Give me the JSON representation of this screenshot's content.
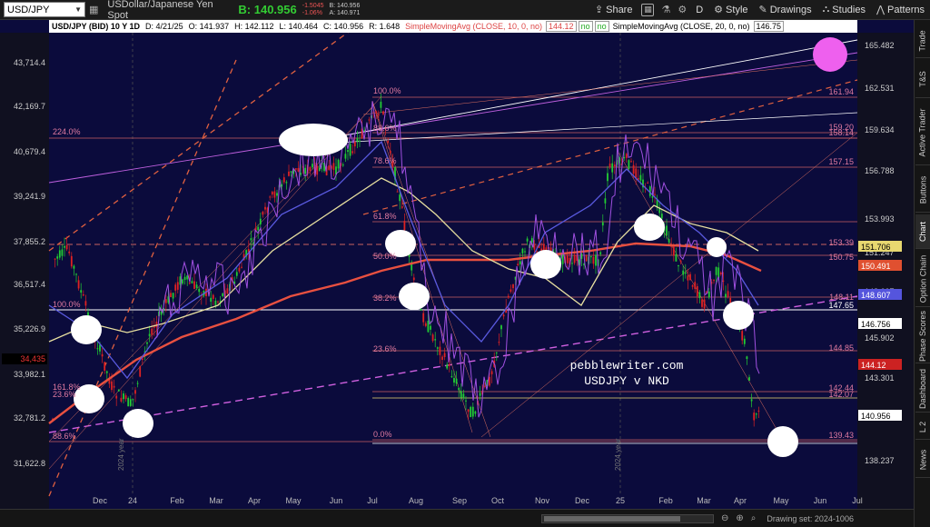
{
  "toolbar": {
    "symbol": "USD/JPY",
    "description": "USDollar/Japanese Yen Spot",
    "bid": "B: 140.956",
    "change": "-1.5045",
    "change_pct": "-1.06%",
    "bid_small": "B: 140.956",
    "ask_small": "A: 140.971",
    "share_label": "Share",
    "style_label": "Style",
    "drawings_label": "Drawings",
    "studies_label": "Studies",
    "patterns_label": "Patterns",
    "period_label": "D"
  },
  "studybar": {
    "title": "USD/JPY (BID) 10 Y 1D",
    "date": "D: 4/21/25",
    "open": "O: 141.937",
    "high": "H: 142.112",
    "low": "L: 140.464",
    "close": "C: 140.956",
    "range": "R: 1.648",
    "sma10": "SimpleMovingAvg (CLOSE, 10, 0, no)",
    "sma10_val": "144.12",
    "no1": "no",
    "no2": "no",
    "sma20": "SimpleMovingAvg (CLOSE, 20, 0, no)",
    "sma20_val": "146.75"
  },
  "right_axis": [
    "165.482",
    "162.531",
    "159.634",
    "156.788",
    "153.993",
    "151.247",
    "148.607",
    "146.756",
    "145.902",
    "143.301",
    "140.956",
    "138.237"
  ],
  "left_axis": [
    "43,714.4",
    "42,169.7",
    "40,679.4",
    "39,241.9",
    "37,855.2",
    "36,517.4",
    "35,226.9",
    "33,982.1",
    "32,781.2",
    "31,622.8"
  ],
  "left_marker": "34,435",
  "x_axis": [
    "Dec",
    "24",
    "Feb",
    "Mar",
    "Apr",
    "May",
    "Jun",
    "Jul",
    "Aug",
    "Sep",
    "Oct",
    "Nov",
    "Dec",
    "25",
    "Feb",
    "Mar",
    "Apr",
    "May",
    "Jun",
    "Jul"
  ],
  "year_labels": [
    "2024 year",
    "2024 year"
  ],
  "fib_left": [
    "224.0%",
    "100.0%",
    "161.8%",
    "23.6%",
    "88.6%"
  ],
  "fib_mid": [
    "100.0%",
    "88.6%",
    "78.6%",
    "61.8%",
    "50.0%",
    "38.2%",
    "23.6%",
    "0.0%"
  ],
  "fib_right": [
    "161.94",
    "159.20",
    "158.14",
    "157.15",
    "153.39",
    "150.75",
    "148.11",
    "147.65",
    "144.85",
    "142.44",
    "142.07",
    "139.43"
  ],
  "price_tags": [
    {
      "text": "151.706",
      "color": "#e8d870"
    },
    {
      "text": "150.491",
      "color": "#e05030"
    },
    {
      "text": "148.607",
      "color": "#5555dd"
    },
    {
      "text": "146.756",
      "color": "#ffffff"
    },
    {
      "text": "144.12",
      "color": "#cc2222"
    },
    {
      "text": "140.956",
      "color": "#ffffff"
    }
  ],
  "watermark1": "pebblewriter.com",
  "watermark2": "USDJPY v NKD",
  "side_tabs": [
    "Trade",
    "T&S",
    "Active Trader",
    "Buttons",
    "Chart",
    "Option Chain",
    "Phase Scores",
    "Dashboard",
    "L 2",
    "News"
  ],
  "drawing_set": "Drawing set: 2024-1006"
}
